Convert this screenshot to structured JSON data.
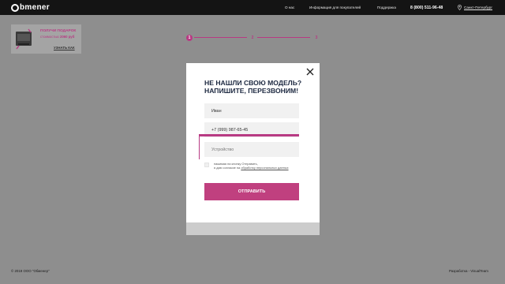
{
  "header": {
    "logo": "bmener",
    "nav": [
      "О нас",
      "Информация для покупателей",
      "Поддержка"
    ],
    "phone": "8 (800) 511-96-48",
    "city": "Санкт-Петербург"
  },
  "promo": {
    "title": "ПОЛУЧИ ПОДАРОК",
    "subtitle_prefix": "стоимостью",
    "subtitle_amount": "2060 руб",
    "link": "УЗНАТЬ КАК"
  },
  "steps": [
    "1",
    "2",
    "3"
  ],
  "modal": {
    "title_line1": "НЕ НАШЛИ СВОЮ МОДЕЛЬ?",
    "title_line2": "НАПИШИТЕ, ПЕРЕЗВОНИМ!",
    "name_value": "Иван",
    "phone_value": "+7 (999) 987-65-45",
    "device_placeholder": "Устройство",
    "consent_line1": "нажимая на кнопку Отправить,",
    "consent_line2_prefix": "я даю согласие на",
    "consent_link": "обработку персональных данных",
    "submit": "ОТПРАВИТЬ"
  },
  "footer": {
    "copyright": "© 2019 ООО \"Обменер\"",
    "developer": "Разработка - VisualTeam"
  },
  "colors": {
    "accent": "#c0407f",
    "topbar": "#141414",
    "overlay": "#8e8e8e"
  }
}
